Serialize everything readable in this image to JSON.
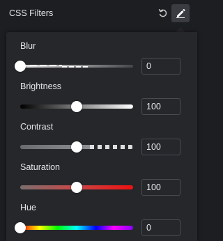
{
  "header": {
    "title": "CSS Filters",
    "reset_icon": "reset-icon",
    "edit_icon": "pencil-icon"
  },
  "filters": [
    {
      "label": "Blur",
      "value": "0",
      "level": 0.0
    },
    {
      "label": "Brightness",
      "value": "100",
      "level": 0.5
    },
    {
      "label": "Contrast",
      "value": "100",
      "level": 0.5
    },
    {
      "label": "Saturation",
      "value": "100",
      "level": 0.5
    },
    {
      "label": "Hue",
      "value": "0",
      "level": 0.0
    }
  ],
  "colors": {
    "background": "#1d1e21",
    "panel": "#26272b",
    "saturation_start": "#8a6a6a",
    "saturation_end": "#e81b1b"
  }
}
